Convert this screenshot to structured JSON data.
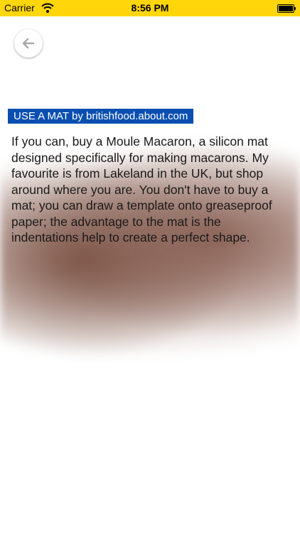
{
  "status_bar": {
    "carrier": "Carrier",
    "time": "8:56 PM"
  },
  "article": {
    "title": "USE A MAT by britishfood.about.com",
    "body": "If you can, buy a Moule Macaron, a silicon mat designed specifically for making macarons. My favourite is from Lakeland in the UK, but shop around where you are. You don't have to buy a mat; you can draw a template onto greaseproof paper; the advantage to the mat is the indentations help to create a perfect shape."
  },
  "colors": {
    "status_bar": "#ffd60a",
    "title_background": "#0a4fb0"
  },
  "icons": {
    "back": "back-arrow-icon",
    "wifi": "wifi-icon",
    "battery": "battery-icon"
  }
}
